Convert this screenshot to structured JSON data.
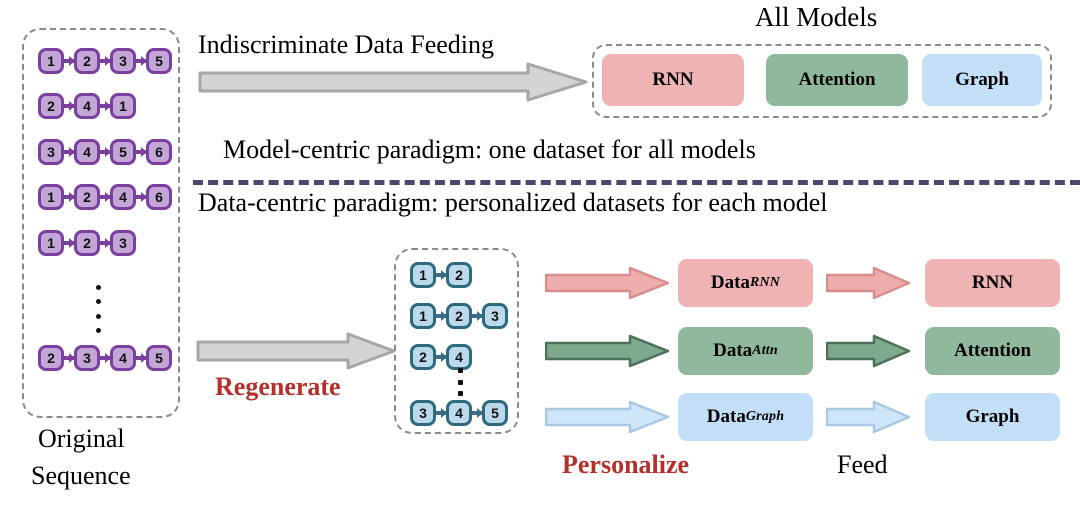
{
  "title": "Data-centric vs Model-centric paradigm diagram",
  "headings": {
    "all_models": "All Models",
    "indiscriminate": "Indiscriminate Data Feeding",
    "model_centric": "Model-centric paradigm: one dataset for all models",
    "data_centric": "Data-centric paradigm: personalized datasets for each model"
  },
  "left_panel": {
    "caption_line1": "Original",
    "caption_line2": "Sequence",
    "sequences": [
      [
        1,
        2,
        3,
        5
      ],
      [
        2,
        4,
        1
      ],
      [
        3,
        4,
        5,
        6
      ],
      [
        1,
        2,
        4,
        6
      ],
      [
        1,
        2,
        3
      ],
      [
        2,
        3,
        4,
        5
      ]
    ],
    "ellipsis": "⋮"
  },
  "regenerated_panel": {
    "sequences": [
      [
        1,
        2
      ],
      [
        1,
        2,
        3
      ],
      [
        2,
        4
      ],
      [
        3,
        4,
        5
      ]
    ],
    "ellipsis": "⋮"
  },
  "stage_labels": {
    "regenerate": "Regenerate",
    "personalize": "Personalize",
    "feed": "Feed"
  },
  "all_models_boxes": [
    {
      "label": "RNN",
      "color": "#f0b3b3",
      "kind": "rnn"
    },
    {
      "label": "Attention",
      "color": "#8fb89c",
      "kind": "attn"
    },
    {
      "label": "Graph",
      "color": "#c3dff7",
      "kind": "graph"
    }
  ],
  "data_boxes": [
    {
      "label": "Data",
      "sub": "RNN",
      "color": "#f0b3b3",
      "kind": "rnn"
    },
    {
      "label": "Data",
      "sub": "Attn",
      "color": "#8fb89c",
      "kind": "attn"
    },
    {
      "label": "Data",
      "sub": "Graph",
      "color": "#c3dff7",
      "kind": "graph"
    }
  ],
  "model_boxes": [
    {
      "label": "RNN",
      "color": "#f0b3b3",
      "kind": "rnn"
    },
    {
      "label": "Attention",
      "color": "#8fb89c",
      "kind": "attn"
    },
    {
      "label": "Graph",
      "color": "#c3dff7",
      "kind": "graph"
    }
  ],
  "colors": {
    "node_purple_fill": "#c3a5d6",
    "node_purple_border": "#7b3fa0",
    "node_blue_fill": "#bcd9ec",
    "node_blue_border": "#2e6a7d",
    "gray_arrow_fill": "#d4d4d4",
    "gray_arrow_stroke": "#a6a6a6",
    "pink": "#f0b3b3",
    "green": "#8fb89c",
    "blue": "#c3dff7",
    "red_text": "#b5302a",
    "divider": "#49496b",
    "dashed_border": "#8a8a8a"
  }
}
